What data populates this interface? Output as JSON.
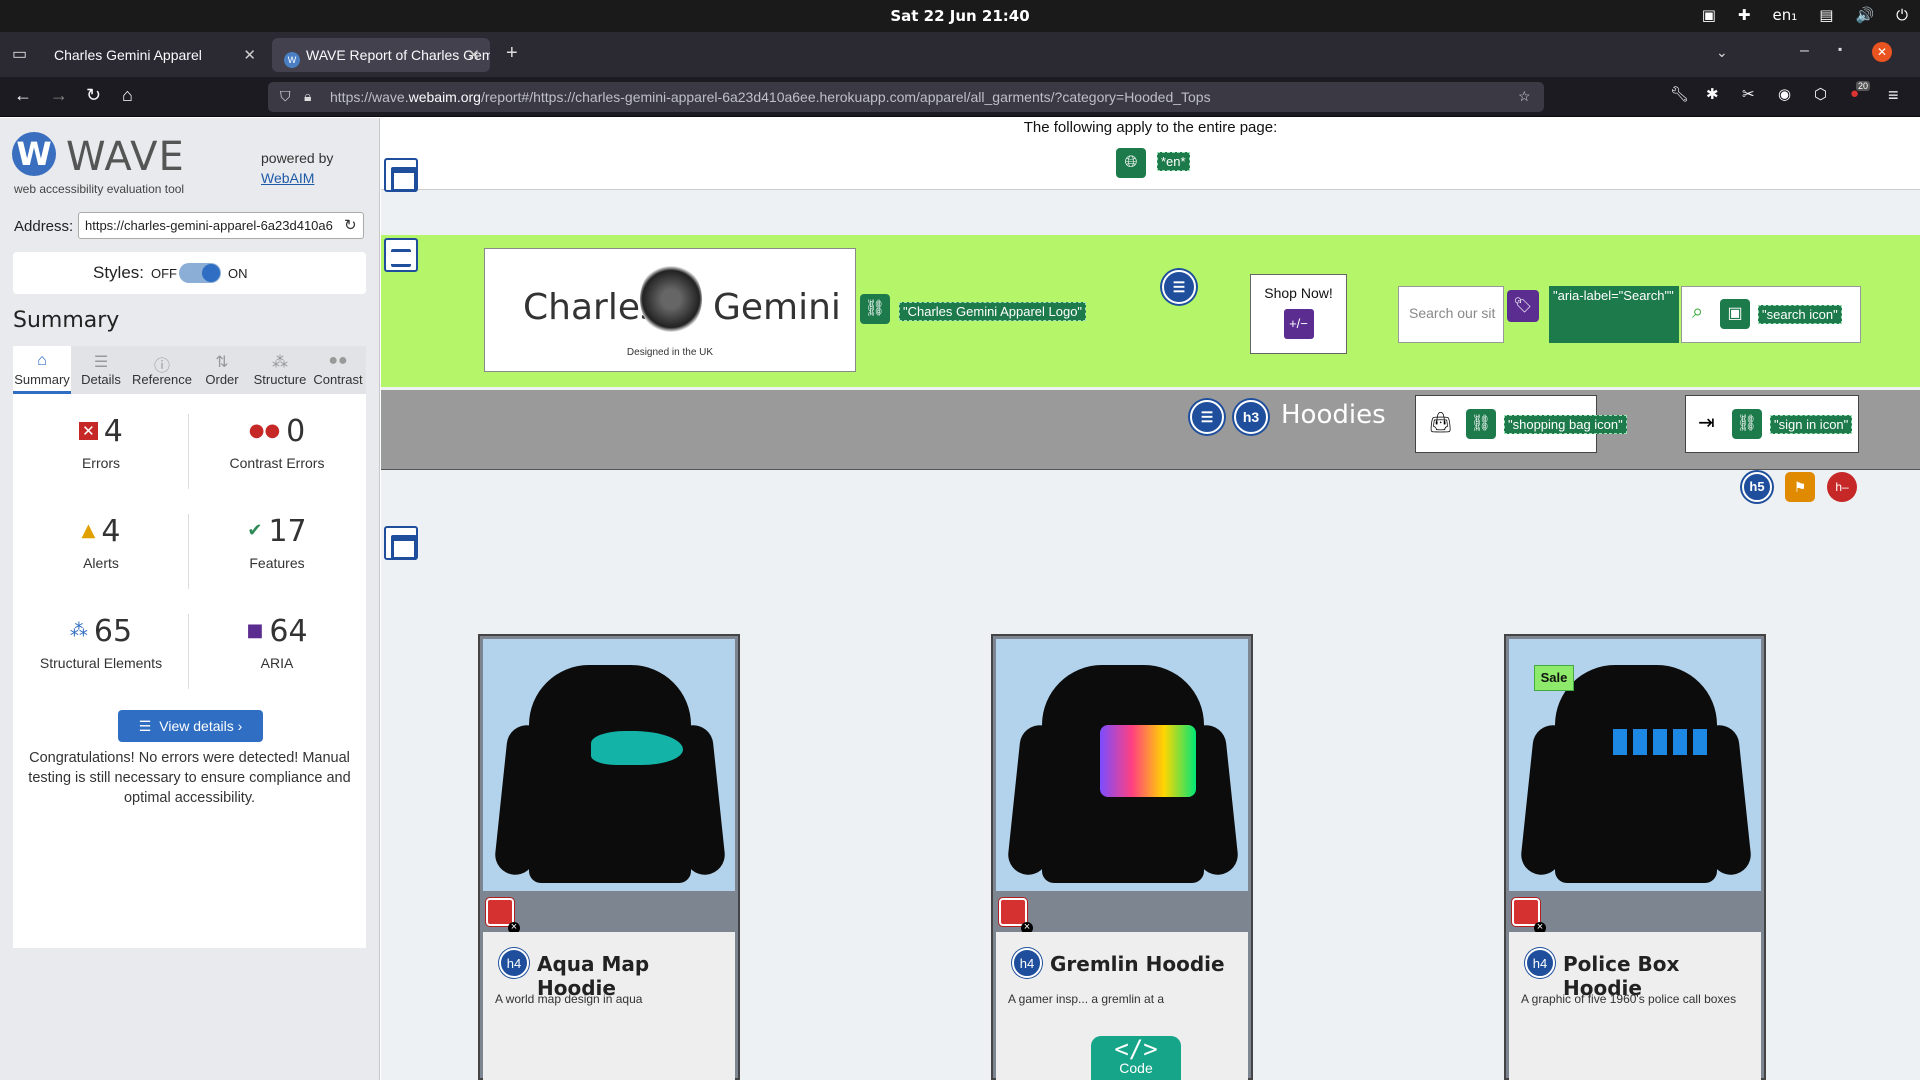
{
  "system": {
    "clock": "Sat 22 Jun  21:40",
    "lang": "en₁"
  },
  "browser": {
    "tabs": [
      {
        "label": "Charles Gemini Apparel"
      },
      {
        "label": "WAVE Report of Charles Gem"
      }
    ],
    "url_prefix": "https://wave.",
    "url_domain": "webaim.org",
    "url_rest": "/report#/https://charles-gemini-apparel-6a23d410a6ee.herokuapp.com/apparel/all_garments/?category=Hooded_Tops",
    "badge_count": "20"
  },
  "wave": {
    "logo_letter": "W",
    "logo_text": "WAVE",
    "logo_sub": "web accessibility evaluation tool",
    "powered_by": "powered by",
    "webaim_link": "WebAIM",
    "address_label": "Address:",
    "address_value": "https://charles-gemini-apparel-6a23d410a6",
    "styles_label": "Styles:",
    "styles_off": "OFF",
    "styles_on": "ON",
    "summary_heading": "Summary",
    "tabs": [
      {
        "label": "Summary",
        "icon": "home-icon"
      },
      {
        "label": "Details",
        "icon": "list-icon"
      },
      {
        "label": "Reference",
        "icon": "info-icon"
      },
      {
        "label": "Order",
        "icon": "order-icon"
      },
      {
        "label": "Structure",
        "icon": "structure-icon"
      },
      {
        "label": "Contrast",
        "icon": "contrast-icon"
      }
    ],
    "stats": {
      "errors": {
        "value": "4",
        "label": "Errors"
      },
      "contrast_errors": {
        "value": "0",
        "label": "Contrast Errors"
      },
      "alerts": {
        "value": "4",
        "label": "Alerts"
      },
      "features": {
        "value": "17",
        "label": "Features"
      },
      "structural": {
        "value": "65",
        "label": "Structural Elements"
      },
      "aria": {
        "value": "64",
        "label": "ARIA"
      }
    },
    "view_details": "View details ›",
    "congrats": "Congratulations! No errors were detected! Manual testing is still necessary to ensure compliance and optimal accessibility."
  },
  "page": {
    "applies_text": "The following apply to the entire page:",
    "lang_label": "*en*",
    "logo_left": "Charles",
    "logo_right": "Gemini",
    "logo_tagline": "Designed in the UK",
    "logo_alt": "\"Charles Gemini Apparel Logo\"",
    "shop_now": "Shop Now!",
    "aria_plus": "+/−",
    "search_placeholder": "Search our sit",
    "aria_label_search": "\"aria-label=\"Search\"\"",
    "search_icon_alt": "\"search icon\"",
    "hoodies_heading": "Hoodies",
    "h3": "h3",
    "shopping_bag_alt": "\"shopping bag icon\"",
    "sign_in_alt": "\"sign in icon\"",
    "h5": "h5",
    "products": [
      {
        "name": "Aqua Map Hoodie",
        "desc": "A world map design in aqua",
        "h": "h4",
        "sale": ""
      },
      {
        "name": "Gremlin Hoodie",
        "desc": "A gamer insp... a gremlin at a",
        "h": "h4",
        "sale": ""
      },
      {
        "name": "Police Box Hoodie",
        "desc": "A graphic of five 1960's police call boxes",
        "h": "h4",
        "sale": "Sale"
      }
    ],
    "code_label": "Code",
    "code_glyph": "</>"
  }
}
